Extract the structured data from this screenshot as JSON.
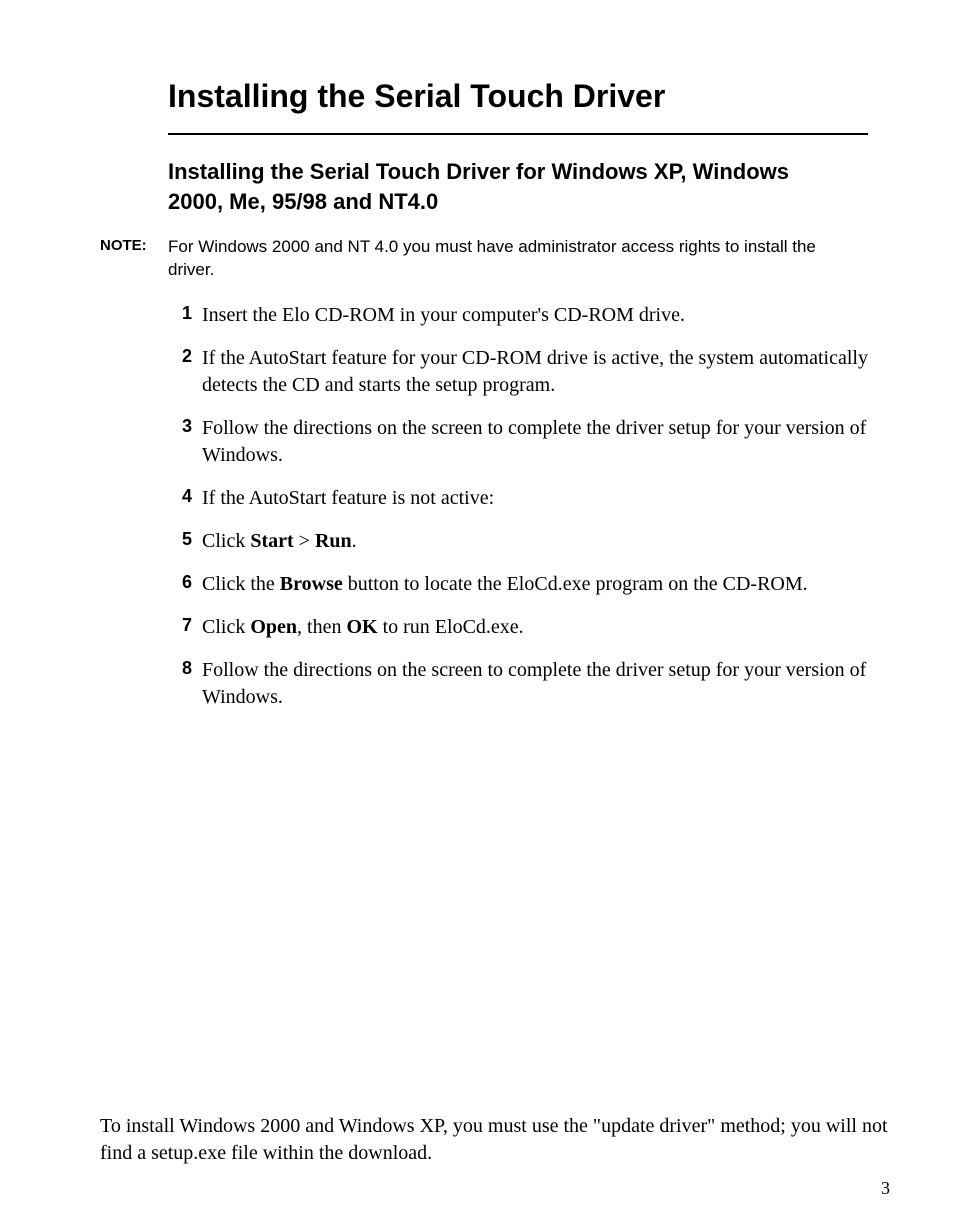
{
  "section_title": "Installing the Serial Touch Driver",
  "subheading": "Installing the Serial Touch Driver for Windows XP, Windows 2000, Me, 95/98 and NT4.0",
  "note": {
    "label": "NOTE:",
    "text": "For Windows 2000 and NT 4.0 you must have administrator access rights to install the driver."
  },
  "steps": [
    {
      "num": "1",
      "parts": [
        "Insert the Elo CD-ROM in your computer's CD-ROM drive."
      ]
    },
    {
      "num": "2",
      "parts": [
        "If the AutoStart feature for your CD-ROM drive is active, the system automatically detects the CD and starts the setup program."
      ]
    },
    {
      "num": "3",
      "parts": [
        "Follow the directions on the screen to complete the driver setup for your version of Windows."
      ]
    },
    {
      "num": "4",
      "parts": [
        "If the AutoStart feature is not active:"
      ]
    },
    {
      "num": "5",
      "parts": [
        "Click ",
        {
          "b": "Start"
        },
        " > ",
        {
          "b": "Run"
        },
        "."
      ]
    },
    {
      "num": "6",
      "parts": [
        "Click the ",
        {
          "b": "Browse"
        },
        " button to locate the EloCd.exe program on the CD-ROM."
      ]
    },
    {
      "num": "7",
      "parts": [
        "Click ",
        {
          "b": "Open"
        },
        ", then ",
        {
          "b": "OK"
        },
        " to run EloCd.exe."
      ]
    },
    {
      "num": "8",
      "parts": [
        "Follow the directions on the screen to complete the driver setup for your version of Windows."
      ]
    }
  ],
  "footer_note": "To install Windows 2000 and Windows XP, you must use the \"update driver\" method; you will not find a setup.exe file within the download.",
  "page_number": "3"
}
